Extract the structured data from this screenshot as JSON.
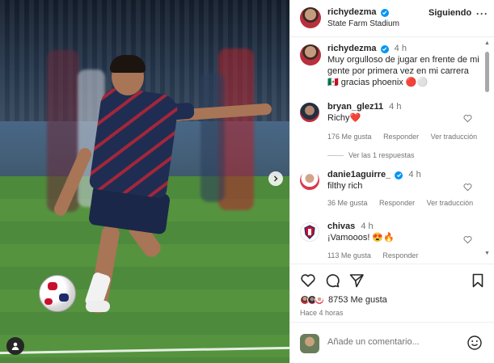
{
  "post": {
    "username": "richydezma",
    "location": "State Farm Stadium",
    "follow_label": "Siguiendo",
    "more_label": "···"
  },
  "caption": {
    "username": "richydezma",
    "time": "4 h",
    "text": "Muy orgulloso de jugar en frente de mi gente por primera vez en mi carrera 🇲🇽 gracias phoenix 🔴⚪"
  },
  "comments": [
    {
      "username": "bryan_glez11",
      "time": "4 h",
      "text": "Richy❤️",
      "likes": "176 Me gusta",
      "reply_label": "Responder",
      "translate_label": "Ver traducción",
      "replies_label": "Ver las 1 respuestas"
    },
    {
      "username": "danie1aguirre_",
      "time": "4 h",
      "text": "filthy rich",
      "likes": "36 Me gusta",
      "reply_label": "Responder",
      "translate_label": "Ver traducción"
    },
    {
      "username": "chivas",
      "time": "4 h",
      "text": "¡Vamooos! 😍🔥",
      "likes": "113 Me gusta",
      "reply_label": "Responder"
    }
  ],
  "actions": {
    "likes_count": "8753 Me gusta",
    "time_ago": "Hace 4 horas"
  },
  "add_comment": {
    "placeholder": "Añade un comentario..."
  },
  "colors": {
    "verified": "#0095f6",
    "text": "#262626",
    "muted": "#737373"
  }
}
